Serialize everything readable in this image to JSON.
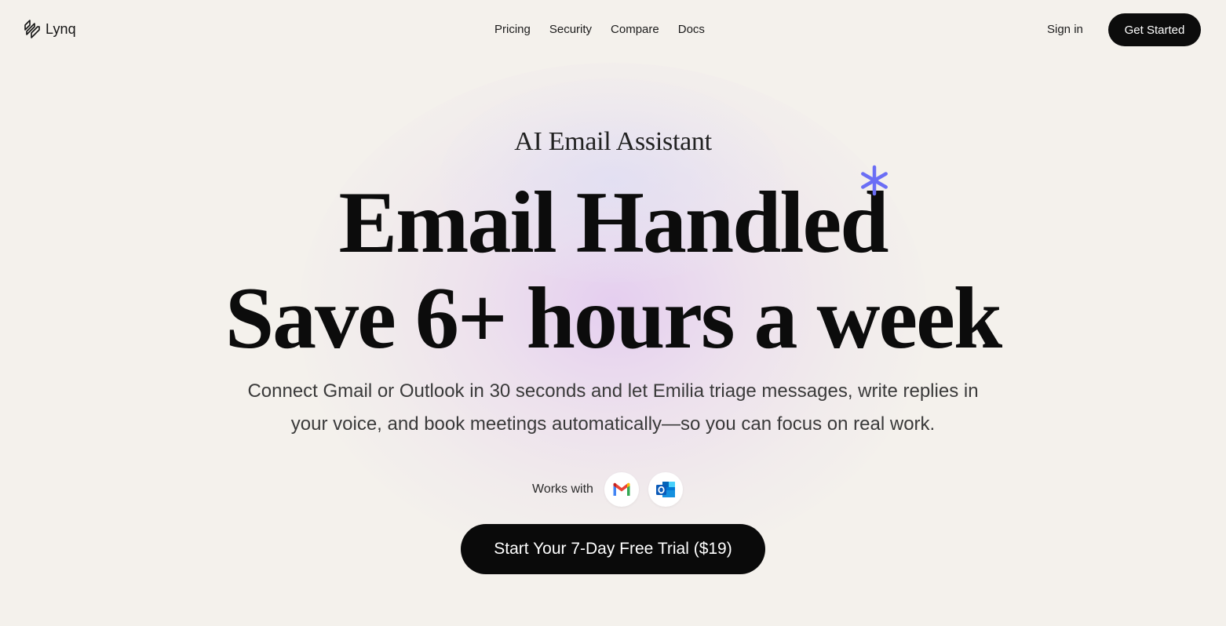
{
  "nav": {
    "brand": "Lynq",
    "links": [
      {
        "label": "Pricing"
      },
      {
        "label": "Security"
      },
      {
        "label": "Compare"
      },
      {
        "label": "Docs"
      }
    ],
    "sign_in": "Sign in",
    "get_started": "Get Started",
    "logo_icon": "lynq-logo-icon"
  },
  "hero": {
    "eyebrow": "AI Email Assistant",
    "headline_line1": "Email Handled",
    "headline_line2": "Save 6+ hours a week",
    "asterisk_color": "#6b6ef5",
    "subtitle_line1": "Connect Gmail or Outlook in 30 seconds and let Emilia triage messages, write replies in",
    "subtitle_line2": "your voice, and book meetings automatically—so you can focus on real work.",
    "works_with_label": "Works with",
    "providers": [
      {
        "name": "gmail-icon"
      },
      {
        "name": "outlook-icon"
      }
    ],
    "cta": "Start Your 7-Day Free Trial ($19)"
  },
  "colors": {
    "background": "#f4f1ec",
    "button": "#0c0c0c",
    "accent": "#6b6ef5"
  }
}
